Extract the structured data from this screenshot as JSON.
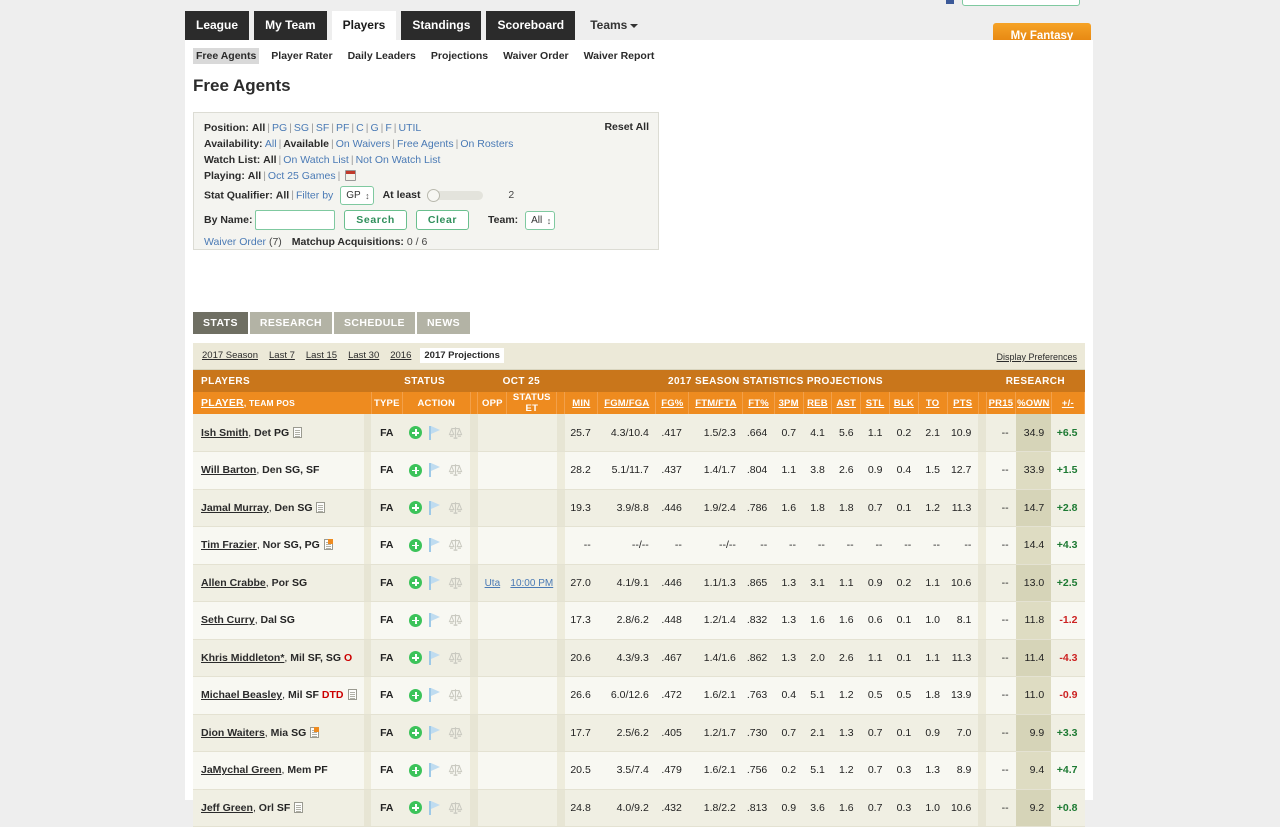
{
  "nav": {
    "tabs": [
      {
        "label": "League",
        "active": false
      },
      {
        "label": "My Team",
        "active": false
      },
      {
        "label": "Players",
        "active": true
      },
      {
        "label": "Standings",
        "active": false
      },
      {
        "label": "Scoreboard",
        "active": false
      }
    ],
    "teams_label": "Teams",
    "my_fantasy_teams": "My Fantasy Teams"
  },
  "subnav": {
    "items": [
      {
        "label": "Free Agents",
        "selected": true
      },
      {
        "label": "Player Rater",
        "selected": false
      },
      {
        "label": "Daily Leaders",
        "selected": false
      },
      {
        "label": "Projections",
        "selected": false
      },
      {
        "label": "Waiver Order",
        "selected": false
      },
      {
        "label": "Waiver Report",
        "selected": false
      }
    ]
  },
  "page_title": "Free Agents",
  "filters": {
    "reset_all": "Reset All",
    "position": {
      "label": "Position:",
      "options": [
        "All",
        "PG",
        "SG",
        "SF",
        "PF",
        "C",
        "G",
        "F",
        "UTIL"
      ],
      "selected": "All"
    },
    "availability": {
      "label": "Availability:",
      "options": [
        "All",
        "Available",
        "On Waivers",
        "Free Agents",
        "On Rosters"
      ],
      "selected": "Available"
    },
    "watch_list": {
      "label": "Watch List:",
      "options": [
        "All",
        "On Watch List",
        "Not On Watch List"
      ],
      "selected": "All"
    },
    "playing": {
      "label": "Playing:",
      "options": [
        "All",
        "Oct 25 Games"
      ],
      "selected": "All"
    },
    "stat_qualifier": {
      "label": "Stat Qualifier:",
      "options": [
        "All",
        "Filter by"
      ],
      "selected": "All",
      "stat_select": "GP",
      "at_least_label": "At least",
      "at_least_value": "2"
    },
    "by_name": {
      "label": "By Name:",
      "value": "",
      "placeholder": "",
      "search_label": "Search",
      "clear_label": "Clear"
    },
    "team": {
      "label": "Team:",
      "selected": "All"
    },
    "waiver_order": {
      "link": "Waiver Order",
      "count": "(7)"
    },
    "matchup_acquisitions": {
      "label": "Matchup Acquisitions:",
      "value": "0 / 6"
    }
  },
  "section_tabs": [
    {
      "label": "STATS",
      "active": true
    },
    {
      "label": "RESEARCH",
      "active": false
    },
    {
      "label": "SCHEDULE",
      "active": false
    },
    {
      "label": "NEWS",
      "active": false
    }
  ],
  "range_tabs": [
    {
      "label": "2017 Season",
      "selected": false
    },
    {
      "label": "Last 7",
      "selected": false
    },
    {
      "label": "Last 15",
      "selected": false
    },
    {
      "label": "Last 30",
      "selected": false
    },
    {
      "label": "2016",
      "selected": false
    },
    {
      "label": "2017 Projections",
      "selected": true
    }
  ],
  "display_preferences": "Display Preferences",
  "table": {
    "group_headers": [
      {
        "label": "PLAYERS",
        "align": "left",
        "span": 1
      },
      {
        "label": "STATUS",
        "align": "center",
        "span": 3
      },
      {
        "label": "OCT 25",
        "align": "center",
        "span": 3
      },
      {
        "label": "2017 SEASON STATISTICS PROJECTIONS",
        "align": "center",
        "span": 13
      },
      {
        "label": "RESEARCH",
        "align": "center",
        "span": 3
      }
    ],
    "col_headers": {
      "player": "PLAYER",
      "team_pos": ", TEAM POS",
      "type": "TYPE",
      "action": "ACTION",
      "opp": "OPP",
      "status_et": "STATUS ET",
      "min": "MIN",
      "fgm_fga": "FGM/FGA",
      "fg_pct": "FG%",
      "ftm_fta": "FTM/FTA",
      "ft_pct": "FT%",
      "three_pm": "3PM",
      "reb": "REB",
      "ast": "AST",
      "stl": "STL",
      "blk": "BLK",
      "to": "TO",
      "pts": "PTS",
      "pr15": "PR15",
      "own_pct": "%OWN",
      "plus_minus": "+/-"
    },
    "rows": [
      {
        "name": "Ish Smith",
        "team": "Det",
        "pos": "PG",
        "note": "news",
        "status": "",
        "type": "FA",
        "opp": "",
        "status_et": "",
        "min": "25.7",
        "fgm_fga": "4.3/10.4",
        "fg_pct": ".417",
        "ftm_fta": "1.5/2.3",
        "ft_pct": ".664",
        "three_pm": "0.7",
        "reb": "4.1",
        "ast": "5.6",
        "stl": "1.1",
        "blk": "0.2",
        "to": "2.1",
        "pts": "10.9",
        "pr15": "--",
        "own_pct": "34.9",
        "plus_minus": "+6.5",
        "pm_sign": "pos"
      },
      {
        "name": "Will Barton",
        "team": "Den",
        "pos": "SG, SF",
        "note": "",
        "status": "",
        "type": "FA",
        "opp": "",
        "status_et": "",
        "min": "28.2",
        "fgm_fga": "5.1/11.7",
        "fg_pct": ".437",
        "ftm_fta": "1.4/1.7",
        "ft_pct": ".804",
        "three_pm": "1.1",
        "reb": "3.8",
        "ast": "2.6",
        "stl": "0.9",
        "blk": "0.4",
        "to": "1.5",
        "pts": "12.7",
        "pr15": "--",
        "own_pct": "33.9",
        "plus_minus": "+1.5",
        "pm_sign": "pos"
      },
      {
        "name": "Jamal Murray",
        "team": "Den",
        "pos": "SG",
        "note": "news",
        "status": "",
        "type": "FA",
        "opp": "",
        "status_et": "",
        "min": "19.3",
        "fgm_fga": "3.9/8.8",
        "fg_pct": ".446",
        "ftm_fta": "1.9/2.4",
        "ft_pct": ".786",
        "three_pm": "1.6",
        "reb": "1.8",
        "ast": "1.8",
        "stl": "0.7",
        "blk": "0.1",
        "to": "1.2",
        "pts": "11.3",
        "pr15": "--",
        "own_pct": "14.7",
        "plus_minus": "+2.8",
        "pm_sign": "pos"
      },
      {
        "name": "Tim Frazier",
        "team": "Nor",
        "pos": "SG, PG",
        "note": "video",
        "status": "",
        "type": "FA",
        "opp": "",
        "status_et": "",
        "min": "--",
        "fgm_fga": "--/--",
        "fg_pct": "--",
        "ftm_fta": "--/--",
        "ft_pct": "--",
        "three_pm": "--",
        "reb": "--",
        "ast": "--",
        "stl": "--",
        "blk": "--",
        "to": "--",
        "pts": "--",
        "pr15": "--",
        "own_pct": "14.4",
        "plus_minus": "+4.3",
        "pm_sign": "pos"
      },
      {
        "name": "Allen Crabbe",
        "team": "Por",
        "pos": "SG",
        "note": "",
        "status": "",
        "type": "FA",
        "opp": "Uta",
        "status_et": "10:00 PM",
        "min": "27.0",
        "fgm_fga": "4.1/9.1",
        "fg_pct": ".446",
        "ftm_fta": "1.1/1.3",
        "ft_pct": ".865",
        "three_pm": "1.3",
        "reb": "3.1",
        "ast": "1.1",
        "stl": "0.9",
        "blk": "0.2",
        "to": "1.1",
        "pts": "10.6",
        "pr15": "--",
        "own_pct": "13.0",
        "plus_minus": "+2.5",
        "pm_sign": "pos"
      },
      {
        "name": "Seth Curry",
        "team": "Dal",
        "pos": "SG",
        "note": "",
        "status": "",
        "type": "FA",
        "opp": "",
        "status_et": "",
        "min": "17.3",
        "fgm_fga": "2.8/6.2",
        "fg_pct": ".448",
        "ftm_fta": "1.2/1.4",
        "ft_pct": ".832",
        "three_pm": "1.3",
        "reb": "1.6",
        "ast": "1.6",
        "stl": "0.6",
        "blk": "0.1",
        "to": "1.0",
        "pts": "8.1",
        "pr15": "--",
        "own_pct": "11.8",
        "plus_minus": "-1.2",
        "pm_sign": "neg"
      },
      {
        "name": "Khris Middleton*",
        "team": "Mil",
        "pos": "SF, SG",
        "note": "",
        "status": "O",
        "type": "FA",
        "opp": "",
        "status_et": "",
        "min": "20.6",
        "fgm_fga": "4.3/9.3",
        "fg_pct": ".467",
        "ftm_fta": "1.4/1.6",
        "ft_pct": ".862",
        "three_pm": "1.3",
        "reb": "2.0",
        "ast": "2.6",
        "stl": "1.1",
        "blk": "0.1",
        "to": "1.1",
        "pts": "11.3",
        "pr15": "--",
        "own_pct": "11.4",
        "plus_minus": "-4.3",
        "pm_sign": "neg"
      },
      {
        "name": "Michael Beasley",
        "team": "Mil",
        "pos": "SF",
        "note": "news",
        "status": "DTD",
        "type": "FA",
        "opp": "",
        "status_et": "",
        "min": "26.6",
        "fgm_fga": "6.0/12.6",
        "fg_pct": ".472",
        "ftm_fta": "1.6/2.1",
        "ft_pct": ".763",
        "three_pm": "0.4",
        "reb": "5.1",
        "ast": "1.2",
        "stl": "0.5",
        "blk": "0.5",
        "to": "1.8",
        "pts": "13.9",
        "pr15": "--",
        "own_pct": "11.0",
        "plus_minus": "-0.9",
        "pm_sign": "neg"
      },
      {
        "name": "Dion Waiters",
        "team": "Mia",
        "pos": "SG",
        "note": "video",
        "status": "",
        "type": "FA",
        "opp": "",
        "status_et": "",
        "min": "17.7",
        "fgm_fga": "2.5/6.2",
        "fg_pct": ".405",
        "ftm_fta": "1.2/1.7",
        "ft_pct": ".730",
        "three_pm": "0.7",
        "reb": "2.1",
        "ast": "1.3",
        "stl": "0.7",
        "blk": "0.1",
        "to": "0.9",
        "pts": "7.0",
        "pr15": "--",
        "own_pct": "9.9",
        "plus_minus": "+3.3",
        "pm_sign": "pos"
      },
      {
        "name": "JaMychal Green",
        "team": "Mem",
        "pos": "PF",
        "note": "",
        "status": "",
        "type": "FA",
        "opp": "",
        "status_et": "",
        "min": "20.5",
        "fgm_fga": "3.5/7.4",
        "fg_pct": ".479",
        "ftm_fta": "1.6/2.1",
        "ft_pct": ".756",
        "three_pm": "0.2",
        "reb": "5.1",
        "ast": "1.2",
        "stl": "0.7",
        "blk": "0.3",
        "to": "1.3",
        "pts": "8.9",
        "pr15": "--",
        "own_pct": "9.4",
        "plus_minus": "+4.7",
        "pm_sign": "pos"
      },
      {
        "name": "Jeff Green",
        "team": "Orl",
        "pos": "SF",
        "note": "news",
        "status": "",
        "type": "FA",
        "opp": "",
        "status_et": "",
        "min": "24.8",
        "fgm_fga": "4.0/9.2",
        "fg_pct": ".432",
        "ftm_fta": "1.8/2.2",
        "ft_pct": ".813",
        "three_pm": "0.9",
        "reb": "3.6",
        "ast": "1.6",
        "stl": "0.7",
        "blk": "0.3",
        "to": "1.0",
        "pts": "10.6",
        "pr15": "--",
        "own_pct": "9.2",
        "plus_minus": "+0.8",
        "pm_sign": "pos"
      }
    ]
  },
  "colors": {
    "group_header_bg": "#c9761b",
    "col_header_bg": "#ee8b1f",
    "accent_orange": "#ee8b1f",
    "positive": "#1d7a33",
    "negative": "#cc2222",
    "link_blue": "#4a7ab5",
    "green_add": "#3cc35a"
  }
}
